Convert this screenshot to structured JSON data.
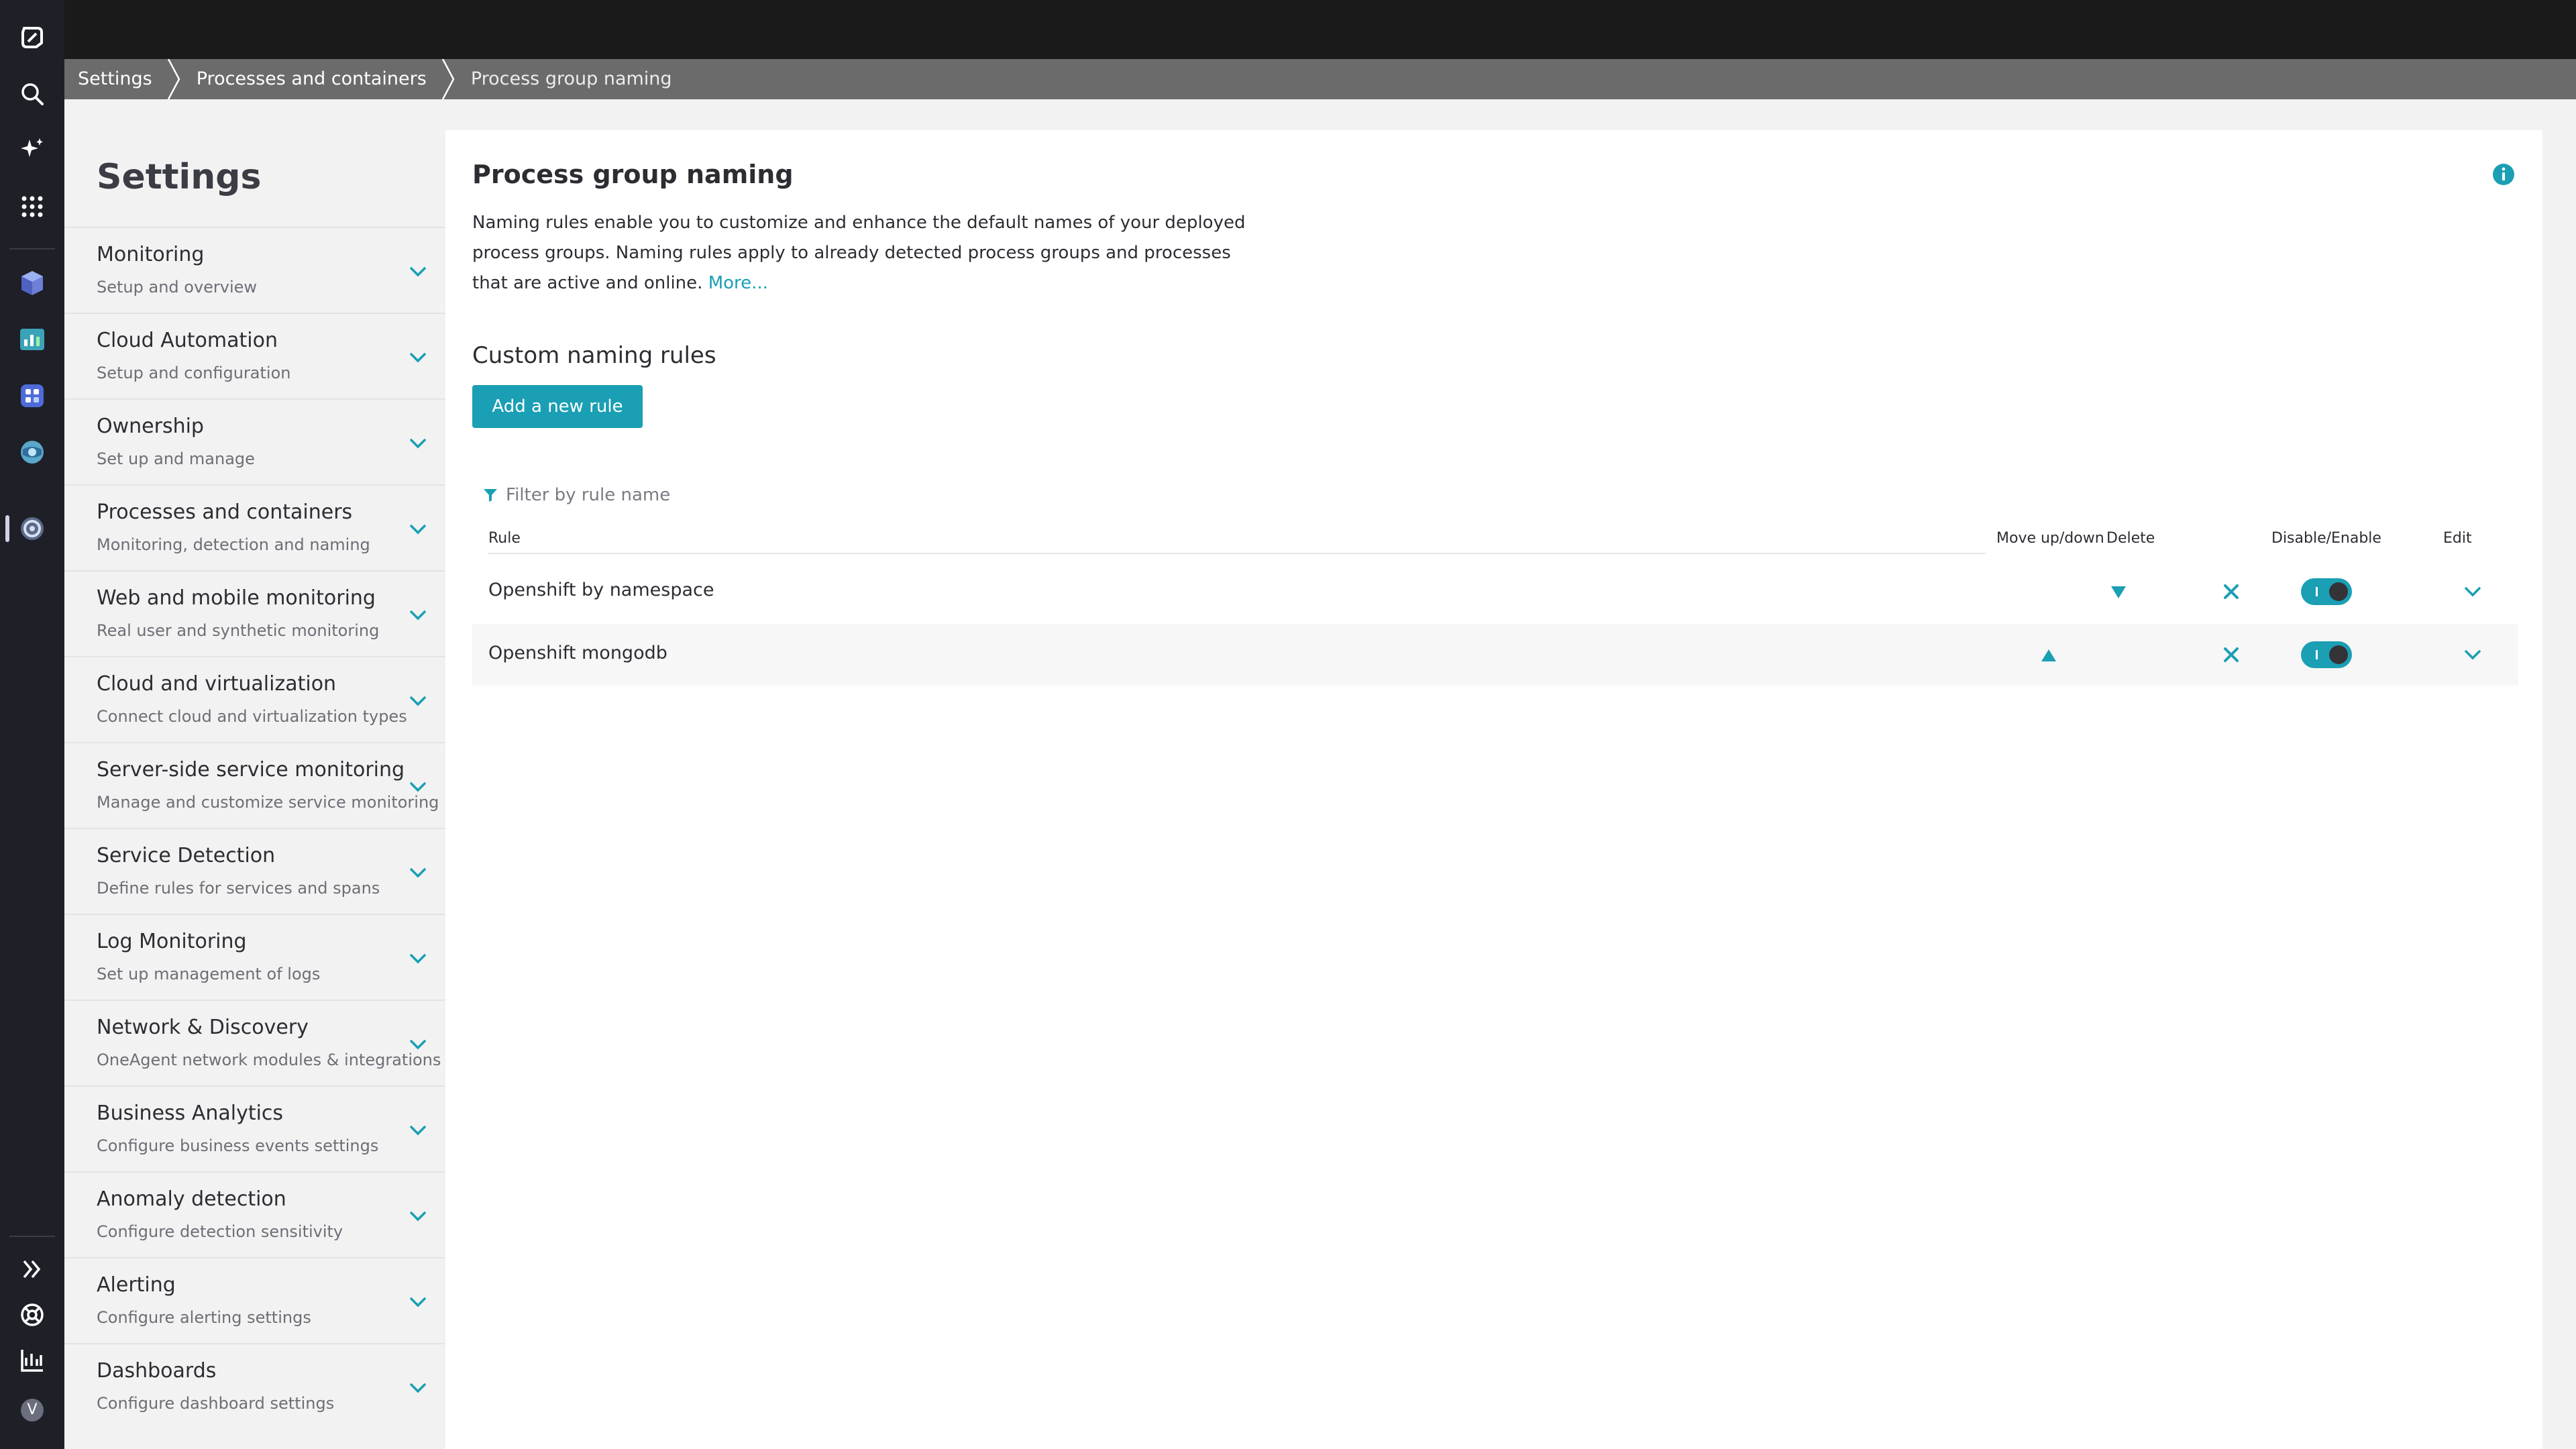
{
  "breadcrumb": [
    {
      "label": "Settings"
    },
    {
      "label": "Processes and containers"
    },
    {
      "label": "Process group naming"
    }
  ],
  "sidebar": {
    "title": "Settings",
    "items": [
      {
        "label": "Monitoring",
        "sub": "Setup and overview"
      },
      {
        "label": "Cloud Automation",
        "sub": "Setup and configuration"
      },
      {
        "label": "Ownership",
        "sub": "Set up and manage"
      },
      {
        "label": "Processes and containers",
        "sub": "Monitoring, detection and naming"
      },
      {
        "label": "Web and mobile monitoring",
        "sub": "Real user and synthetic monitoring"
      },
      {
        "label": "Cloud and virtualization",
        "sub": "Connect cloud and virtualization types"
      },
      {
        "label": "Server-side service monitoring",
        "sub": "Manage and customize service monitoring"
      },
      {
        "label": "Service Detection",
        "sub": "Define rules for services and spans"
      },
      {
        "label": "Log Monitoring",
        "sub": "Set up management of logs"
      },
      {
        "label": "Network & Discovery",
        "sub": "OneAgent network modules & integrations"
      },
      {
        "label": "Business Analytics",
        "sub": "Configure business events settings"
      },
      {
        "label": "Anomaly detection",
        "sub": "Configure detection sensitivity"
      },
      {
        "label": "Alerting",
        "sub": "Configure alerting settings"
      },
      {
        "label": "Dashboards",
        "sub": "Configure dashboard settings"
      }
    ]
  },
  "main": {
    "title": "Process group naming",
    "description": "Naming rules enable you to customize and enhance the default names of your deployed process groups. Naming rules apply to already detected process groups and processes that are active and online.",
    "more_link": "More...",
    "section_title": "Custom naming rules",
    "add_button": "Add a new rule",
    "filter_placeholder": "Filter by rule name",
    "columns": {
      "rule": "Rule",
      "move": "Move up/down",
      "delete": "Delete",
      "toggle": "Disable/Enable",
      "edit": "Edit"
    },
    "rules": [
      {
        "name": "Openshift by namespace",
        "enabled": true
      },
      {
        "name": "Openshift mongodb",
        "enabled": true
      }
    ]
  },
  "colors": {
    "accent": "#1a9fb4",
    "rail": "#1e1f27",
    "breadcrumb": "#6b6b6b"
  },
  "icons": {
    "rail": [
      "dynatrace-logo-icon",
      "search-icon",
      "ai-sparkle-icon",
      "apps-grid-icon",
      "cube-app-icon",
      "chart-app-icon",
      "dashboard-app-icon",
      "globe-app-icon",
      "settings-app-icon",
      "expand-icon",
      "help-icon",
      "reports-icon",
      "user-avatar-icon"
    ],
    "user_initial": "V"
  }
}
